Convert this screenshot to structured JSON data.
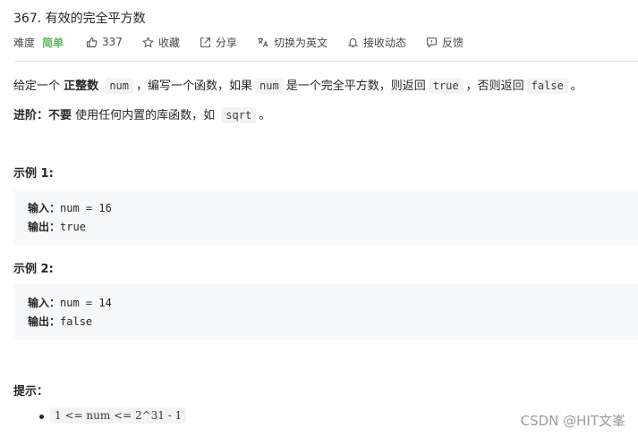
{
  "problem": {
    "title": "367. 有效的完全平方数",
    "difficulty_label": "难度",
    "difficulty": "简单",
    "likes": "337",
    "collect": "收藏",
    "share": "分享",
    "switch_lang": "切换为英文",
    "notify": "接收动态",
    "feedback": "反馈"
  },
  "description": {
    "p1_a": "给定一个",
    "p1_bold": "正整数",
    "p1_code1": "num",
    "p1_b": "，编写一个函数，如果",
    "p1_code2": "num",
    "p1_c": "是一个完全平方数，则返回",
    "p1_code3": "true",
    "p1_d": "，否则返回",
    "p1_code4": "false",
    "p1_e": "。",
    "p2_bold1": "进阶：",
    "p2_bold2": "不要",
    "p2_a": "使用任何内置的库函数，如",
    "p2_code": "sqrt",
    "p2_b": "。"
  },
  "examples": [
    {
      "heading": "示例 1:",
      "input_label": "输入：",
      "input": "num = 16",
      "output_label": "输出：",
      "output": "true"
    },
    {
      "heading": "示例 2:",
      "input_label": "输入：",
      "input": "num = 14",
      "output_label": "输出：",
      "output": "false"
    }
  ],
  "hints": {
    "heading": "提示：",
    "items": [
      "1 <= num <= 2^31 - 1"
    ]
  },
  "watermark": "CSDN @HIT文峯",
  "colors": {
    "difficulty_easy": "#5cb85c",
    "example_bg": "#f7f8fa",
    "code_bg": "#f3f3f3"
  }
}
